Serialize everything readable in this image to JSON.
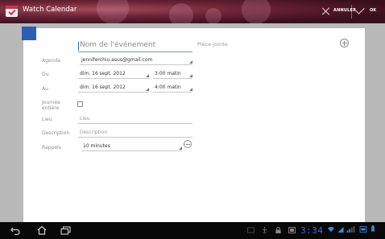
{
  "app": {
    "title": "Watch Calendar"
  },
  "actions": {
    "cancel_label": "ANNULER",
    "ok_label": "OK"
  },
  "event": {
    "title_placeholder": "Nom de l'événement",
    "attachment_label": "Pièce-jointe",
    "agenda": {
      "label": "Agenda",
      "value": "jenniferchiu.asus@gmail.com"
    },
    "from": {
      "label": "Du",
      "date": "dim. 16 sept. 2012",
      "time": "3:00 matin"
    },
    "to": {
      "label": "Au",
      "date": "dim. 16 sept. 2012",
      "time": "4:00 matin"
    },
    "all_day": {
      "label_line1": "Journée",
      "label_line2": "entière",
      "checked": false
    },
    "location": {
      "label": "Lieu",
      "placeholder": "Lieu"
    },
    "description": {
      "label": "Description",
      "placeholder": "Description"
    },
    "reminders": {
      "label": "Rappels",
      "value": "10 minutes"
    },
    "calendar_color": "#2a5fb3"
  },
  "system_bar": {
    "clock": "3:34"
  },
  "colors": {
    "accent": "#2b6ed6",
    "title_bar": "#6e2436",
    "clock": "#3c6bd9"
  }
}
